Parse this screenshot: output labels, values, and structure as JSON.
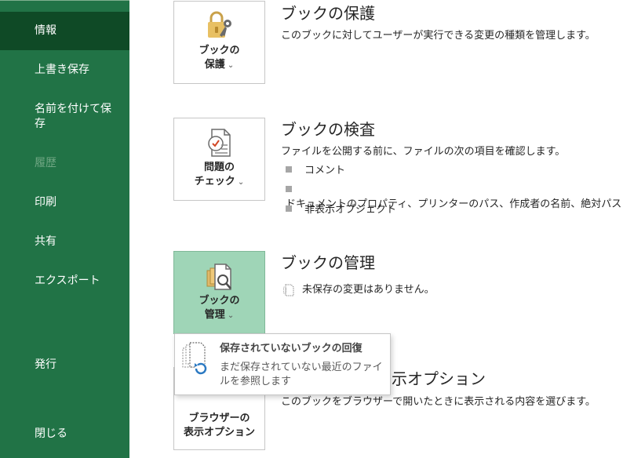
{
  "sidebar": {
    "items": [
      {
        "label": "情報"
      },
      {
        "label": "上書き保存"
      },
      {
        "label": "名前を付けて保存"
      },
      {
        "label": "履歴"
      },
      {
        "label": "印刷"
      },
      {
        "label": "共有"
      },
      {
        "label": "エクスポート"
      },
      {
        "label": "発行"
      },
      {
        "label": "閉じる"
      }
    ]
  },
  "protect": {
    "tile_line1": "ブックの",
    "tile_line2": "保護",
    "title": "ブックの保護",
    "desc": "このブックに対してユーザーが実行できる変更の種類を管理します。"
  },
  "inspect": {
    "tile_line1": "問題の",
    "tile_line2": "チェック",
    "title": "ブックの検査",
    "desc": "ファイルを公開する前に、ファイルの次の項目を確認します。",
    "bullets": [
      "コメント",
      "ドキュメントのプロパティ、プリンターのパス、作成者の名前、絶対パス",
      "非表示オブジェクト"
    ]
  },
  "manage": {
    "tile_line1": "ブックの",
    "tile_line2": "管理",
    "title": "ブックの管理",
    "status": "未保存の変更はありません。"
  },
  "browser": {
    "tile_line1": "ブラウザーの",
    "tile_line2": "表示オプション",
    "title_visible": "示オプション",
    "desc": "このブックをブラウザーで開いたときに表示される内容を選びます。"
  },
  "popup": {
    "title": "保存されていないブックの回復",
    "desc": "まだ保存されていない最近のファイルを参照します"
  },
  "chevron": "⌄",
  "colors": {
    "sidebar_bg": "#217346",
    "sidebar_active": "#0f4a26",
    "tile_selected": "#9fd5b7"
  }
}
